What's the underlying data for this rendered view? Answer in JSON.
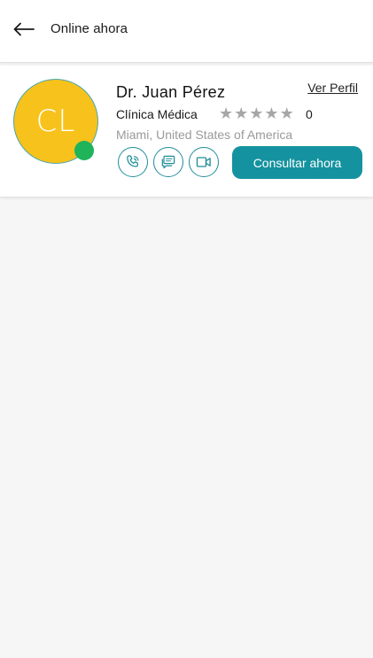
{
  "header": {
    "back_icon": "arrow-left-icon",
    "title": "Online ahora"
  },
  "doctor": {
    "avatar_initials": "CL",
    "avatar_color": "#f7c21b",
    "status": "online",
    "status_color": "#1fb35a",
    "name": "Dr. Juan Pérez",
    "profile_link": "Ver Perfil",
    "specialty": "Clínica Médica",
    "rating_stars": 0,
    "rating_max": 5,
    "rating_count": "0",
    "location": "Miami, United States of America",
    "actions": {
      "phone_icon": "phone-icon",
      "chat_icon": "chat-icon",
      "video_icon": "video-camera-icon"
    },
    "consult_button": "Consultar ahora"
  },
  "colors": {
    "accent": "#14929f",
    "star_empty": "#a6a6a6",
    "location_text": "#9a9a9a"
  }
}
